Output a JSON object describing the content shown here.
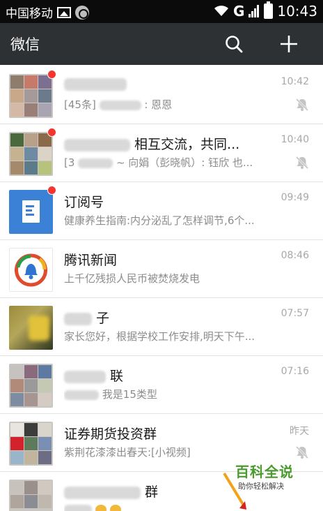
{
  "status_bar": {
    "carrier": "中国移动",
    "time": "10:43",
    "network": "G"
  },
  "header": {
    "title": "微信",
    "search_icon": "search-icon",
    "add_icon": "plus-icon"
  },
  "chats": [
    {
      "name": "",
      "preview_prefix": "[45条]",
      "preview_suffix": ": 恩恩",
      "time": "10:42",
      "unread_dot": true,
      "muted": true
    },
    {
      "name": "相互交流，共同...",
      "preview_prefix": "[3",
      "preview_suffix": "~ 向娟（彭晓帆）: 钰欣 也...",
      "time": "10:40",
      "unread_dot": true,
      "muted": true
    },
    {
      "name": "订阅号",
      "preview": "健康养生指南:内分泌乱了怎样调节,6个...",
      "time": "09:49",
      "unread_dot": true,
      "muted": false
    },
    {
      "name": "腾讯新闻",
      "preview": "上千亿残损人民币被焚烧发电",
      "time": "08:46",
      "unread_dot": false,
      "muted": false
    },
    {
      "name": "子",
      "preview": "家长您好，根据学校工作安排,明天下午...",
      "time": "07:57",
      "unread_dot": false,
      "muted": false
    },
    {
      "name": "联",
      "preview": "我是15类型",
      "time": "07:16",
      "unread_dot": false,
      "muted": false
    },
    {
      "name": "证券期货投资群",
      "preview": "紫荆花漆漆出春天:[小视频]",
      "time": "昨天",
      "unread_dot": false,
      "muted": true
    },
    {
      "name": "群",
      "preview": "",
      "time": "",
      "unread_dot": false,
      "muted": false
    }
  ],
  "watermark": {
    "title": "百科全说",
    "subtitle": "助你轻松解决"
  },
  "colors": {
    "header_bg": "#2e3133",
    "badge": "#f43530",
    "subscription_avatar": "#3b82d6",
    "watermark_green": "#4a9a2d"
  }
}
